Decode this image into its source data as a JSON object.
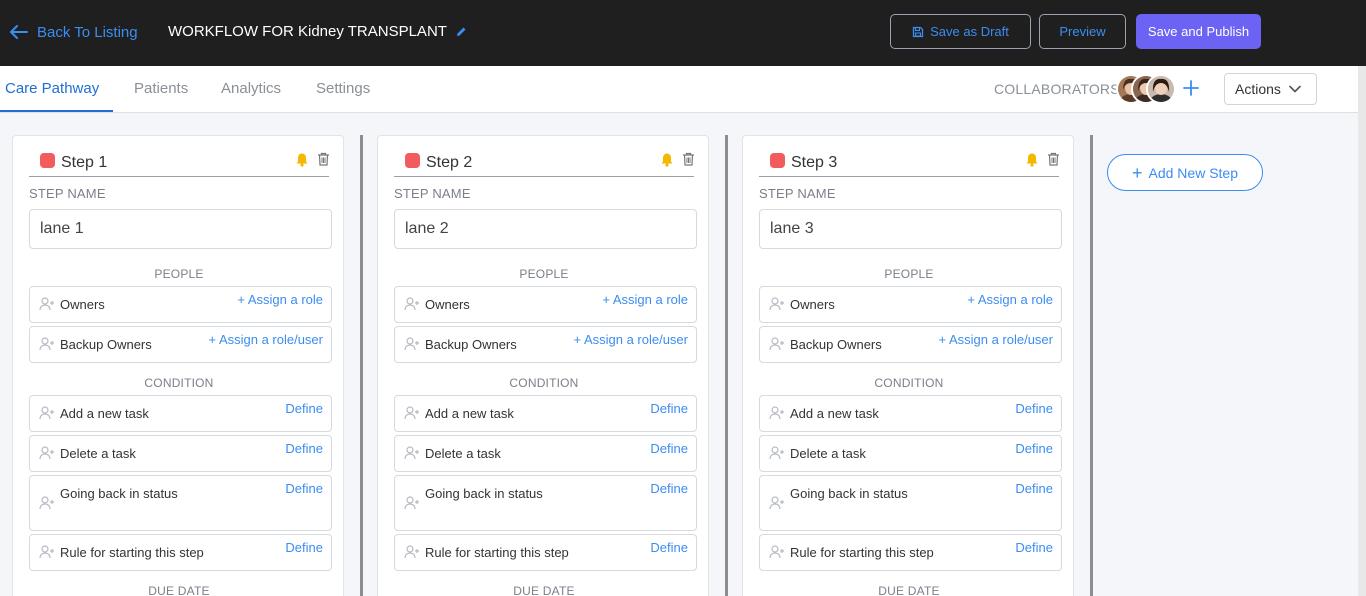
{
  "header": {
    "back_label": "Back To Listing",
    "workflow_title": "WORKFLOW FOR Kidney TRANSPLANT",
    "save_draft_label": "Save as Draft",
    "preview_label": "Preview",
    "publish_label": "Save and Publish"
  },
  "tabs": [
    {
      "label": "Care Pathway",
      "active": true
    },
    {
      "label": "Patients",
      "active": false
    },
    {
      "label": "Analytics",
      "active": false
    },
    {
      "label": "Settings",
      "active": false
    }
  ],
  "collaborators": {
    "label": "COLLABORATORS",
    "count": 3
  },
  "actions_label": "Actions",
  "add_step_label": "Add New Step",
  "steps": [
    {
      "title": "Step 1",
      "step_name_label": "STEP NAME",
      "step_name_value": "lane 1",
      "people_label": "PEOPLE",
      "owners_label": "Owners",
      "owners_link": "+ Assign a role",
      "backup_label": "Backup Owners",
      "backup_link": "+ Assign a role/user",
      "condition_label": "CONDITION",
      "conditions": [
        {
          "label": "Add a new task",
          "link": "Define"
        },
        {
          "label": "Delete a task",
          "link": "Define"
        },
        {
          "label": "Going back in status",
          "link": "Define"
        },
        {
          "label": "Rule for starting this step",
          "link": "Define"
        }
      ],
      "due_date_label": "DUE DATE"
    },
    {
      "title": "Step 2",
      "step_name_label": "STEP NAME",
      "step_name_value": "lane 2",
      "people_label": "PEOPLE",
      "owners_label": "Owners",
      "owners_link": "+ Assign a role",
      "backup_label": "Backup Owners",
      "backup_link": "+ Assign a role/user",
      "condition_label": "CONDITION",
      "conditions": [
        {
          "label": "Add a new task",
          "link": "Define"
        },
        {
          "label": "Delete a task",
          "link": "Define"
        },
        {
          "label": "Going back in status",
          "link": "Define"
        },
        {
          "label": "Rule for starting this step",
          "link": "Define"
        }
      ],
      "due_date_label": "DUE DATE"
    },
    {
      "title": "Step 3",
      "step_name_label": "STEP NAME",
      "step_name_value": "lane 3",
      "people_label": "PEOPLE",
      "owners_label": "Owners",
      "owners_link": "+ Assign a role",
      "backup_label": "Backup Owners",
      "backup_link": "+ Assign a role/user",
      "condition_label": "CONDITION",
      "conditions": [
        {
          "label": "Add a new task",
          "link": "Define"
        },
        {
          "label": "Delete a task",
          "link": "Define"
        },
        {
          "label": "Going back in status",
          "link": "Define"
        },
        {
          "label": "Rule for starting this step",
          "link": "Define"
        }
      ],
      "due_date_label": "DUE DATE"
    }
  ],
  "colors": {
    "topbar_bg": "#1f1f1f",
    "accent_blue": "#3b8df0",
    "publish_purple": "#6c63f5",
    "step_dot_red": "#f25c5c",
    "bell_yellow": "#f5b800"
  }
}
